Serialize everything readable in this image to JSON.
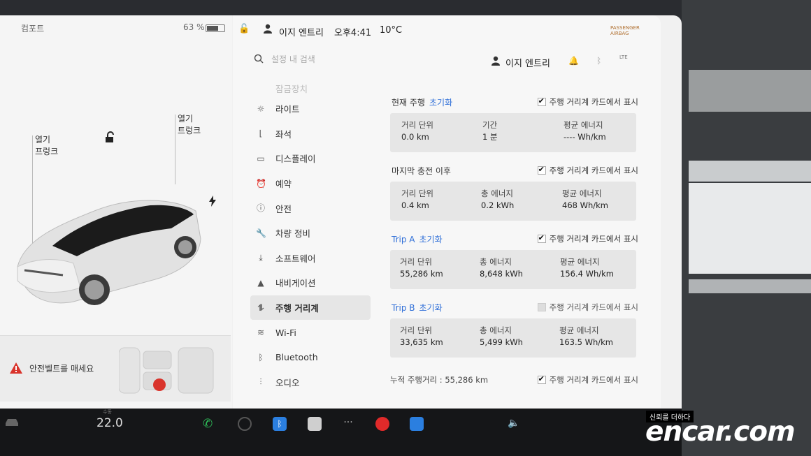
{
  "car_panel": {
    "mode": "컴포트",
    "battery": "63 %",
    "frunk_label": [
      "열기",
      "프렁크"
    ],
    "trunk_label": [
      "열기",
      "트렁크"
    ],
    "alert": "안전벨트를 매세요"
  },
  "status_bar": {
    "user": "이지 엔트리",
    "time": "오후4:41",
    "temperature": "10°C",
    "airbag": [
      "PASSENGER",
      "AIRBAG"
    ]
  },
  "search": {
    "placeholder": "설정 내 검색",
    "user": "이지 엔트리",
    "signal": "LTE"
  },
  "menu": {
    "items": [
      {
        "label": "잠금장치",
        "icon": "lock-icon"
      },
      {
        "label": "라이트",
        "icon": "sun-icon"
      },
      {
        "label": "좌석",
        "icon": "seat-icon"
      },
      {
        "label": "디스플레이",
        "icon": "display-icon"
      },
      {
        "label": "예약",
        "icon": "alarm-icon"
      },
      {
        "label": "안전",
        "icon": "info-icon"
      },
      {
        "label": "차량 정비",
        "icon": "wrench-icon"
      },
      {
        "label": "소프트웨어",
        "icon": "download-icon"
      },
      {
        "label": "내비게이션",
        "icon": "navigation-icon"
      },
      {
        "label": "주행 거리계",
        "icon": "trip-icon"
      },
      {
        "label": "Wi-Fi",
        "icon": "wifi-icon"
      },
      {
        "label": "Bluetooth",
        "icon": "bluetooth-icon"
      },
      {
        "label": "오디오",
        "icon": "equalizer-icon"
      }
    ]
  },
  "trips": {
    "show_label": "주행 거리계 카드에서 표시",
    "reset_label": "초기화",
    "current": {
      "title": "현재 주행",
      "checked": true,
      "stats": [
        {
          "label": "거리 단위",
          "value": "0.0 km"
        },
        {
          "label": "기간",
          "value": "1 분"
        },
        {
          "label": "평균 에너지",
          "value": "---- Wh/km"
        }
      ]
    },
    "since_charge": {
      "title": "마지막 충전 이후",
      "checked": true,
      "stats": [
        {
          "label": "거리 단위",
          "value": "0.4 km"
        },
        {
          "label": "총 에너지",
          "value": "0.2 kWh"
        },
        {
          "label": "평균 에너지",
          "value": "468 Wh/km"
        }
      ]
    },
    "trip_a": {
      "title": "Trip A",
      "checked": true,
      "stats": [
        {
          "label": "거리 단위",
          "value": "55,286 km"
        },
        {
          "label": "총 에너지",
          "value": "8,648 kWh"
        },
        {
          "label": "평균 에너지",
          "value": "156.4 Wh/km"
        }
      ]
    },
    "trip_b": {
      "title": "Trip B",
      "checked": false,
      "stats": [
        {
          "label": "거리 단위",
          "value": "33,635 km"
        },
        {
          "label": "총 에너지",
          "value": "5,499 kWh"
        },
        {
          "label": "평균 에너지",
          "value": "163.5 Wh/km"
        }
      ]
    },
    "odometer": "누적 주행거리 : 55,286 km",
    "odometer_checked": true
  },
  "bottom_bar": {
    "temp_label": "수동",
    "temp": "22.0"
  },
  "watermark": {
    "tag": "신뢰를 더하다",
    "logo": "encar.com"
  },
  "colors": {
    "accent": "#2f6fd8",
    "screen_bg": "#f7f7f7",
    "box_bg": "#e6e6e6",
    "alert_red": "#d9332b"
  }
}
